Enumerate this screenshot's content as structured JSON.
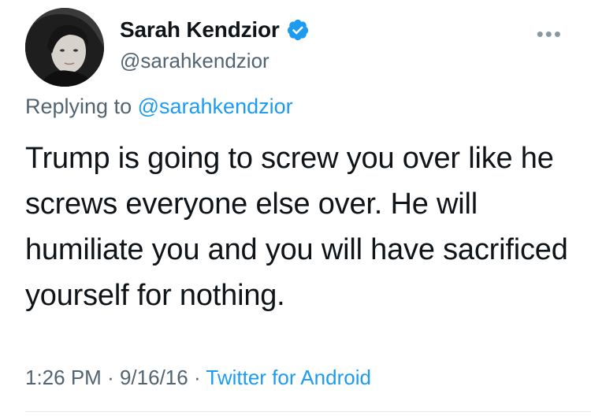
{
  "tweet": {
    "author": {
      "display_name": "Sarah Kendzior",
      "handle": "@sarahkendzior",
      "verified": true,
      "avatar_icon": "user-photo"
    },
    "more_icon": "ellipsis-icon",
    "reply": {
      "prefix": "Replying to",
      "mention": "@sarahkendzior"
    },
    "text": "Trump is going to screw you over like he screws everyone else over. He will humiliate you and you will have sacrificed yourself for nothing.",
    "meta": {
      "time": "1:26 PM",
      "separator_1": "·",
      "date": "9/16/16",
      "separator_2": "·",
      "source": "Twitter for Android"
    }
  },
  "colors": {
    "link": "#1d9bf0",
    "secondary_text": "#536471",
    "primary_text": "#0f1419",
    "verified_badge": "#1d9bf0"
  }
}
